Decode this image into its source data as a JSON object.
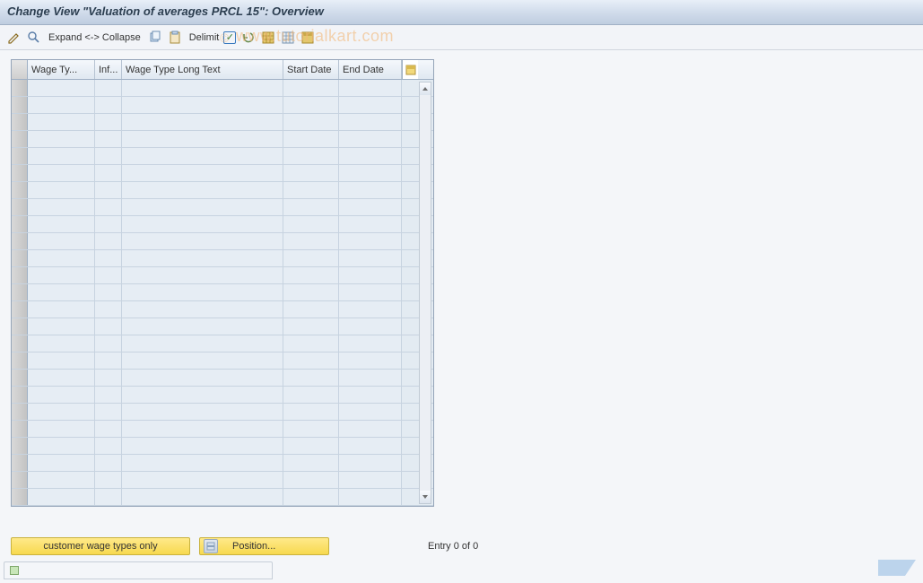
{
  "title": "Change View \"Valuation of averages PRCL 15\": Overview",
  "toolbar": {
    "expand_collapse": "Expand <-> Collapse",
    "delimit": "Delimit"
  },
  "columns": {
    "wt": "Wage Ty...",
    "inf": "Inf...",
    "long": "Wage Type Long Text",
    "sd": "Start Date",
    "ed": "End Date"
  },
  "footer": {
    "customer_btn": "customer wage types only",
    "position_btn": "Position...",
    "entry_text": "Entry 0 of 0"
  },
  "watermark": "www.tutorialkart.com",
  "watermark_copy": "©"
}
